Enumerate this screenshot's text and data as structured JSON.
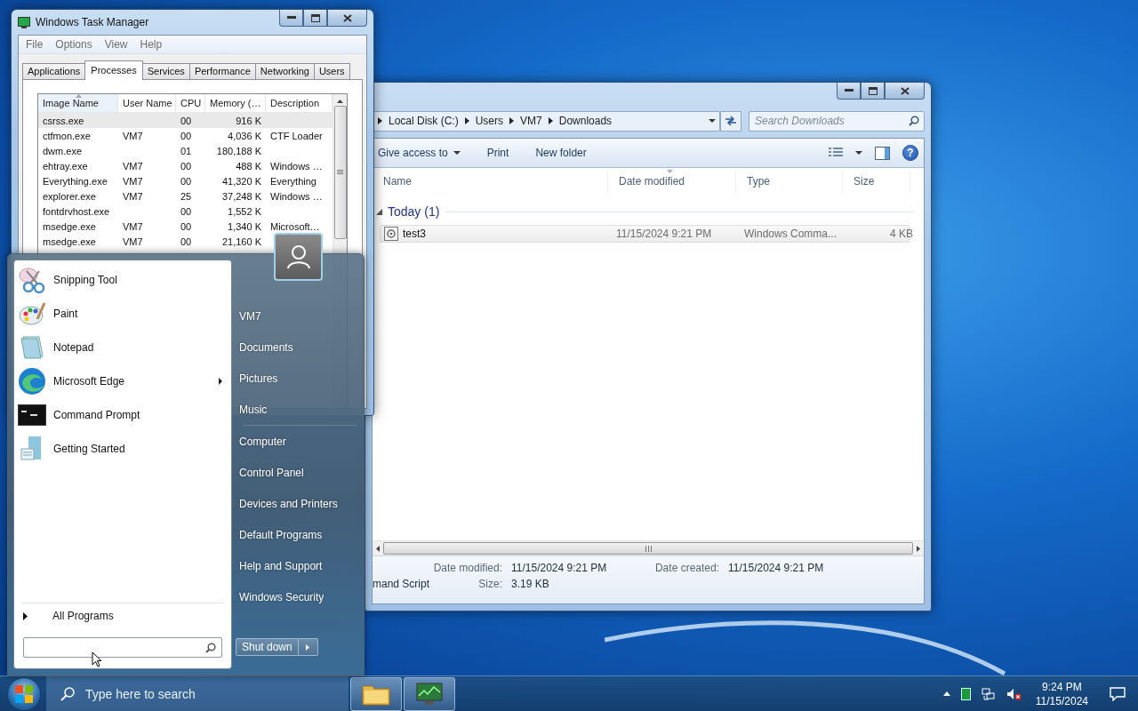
{
  "task_manager": {
    "title": "Windows Task Manager",
    "menu": [
      "File",
      "Options",
      "View",
      "Help"
    ],
    "tabs": [
      {
        "label": "Applications",
        "selected": false
      },
      {
        "label": "Processes",
        "selected": true
      },
      {
        "label": "Services",
        "selected": false
      },
      {
        "label": "Performance",
        "selected": false
      },
      {
        "label": "Networking",
        "selected": false
      },
      {
        "label": "Users",
        "selected": false
      }
    ],
    "columns": [
      "Image Name",
      "User Name",
      "CPU",
      "Memory (…",
      "Description"
    ],
    "rows": [
      {
        "name": "csrss.exe",
        "cpu": "00",
        "memory": "916 K",
        "selected": true
      },
      {
        "name": "ctfmon.exe",
        "user": "VM7",
        "cpu": "00",
        "memory": "4,036 K",
        "description": "CTF Loader",
        "selected": false
      },
      {
        "name": "dwm.exe",
        "cpu": "01",
        "memory": "180,188 K",
        "selected": false
      },
      {
        "name": "ehtray.exe",
        "user": "VM7",
        "cpu": "00",
        "memory": "488 K",
        "description": "Windows …",
        "selected": false
      },
      {
        "name": "Everything.exe",
        "user": "VM7",
        "cpu": "00",
        "memory": "41,320 K",
        "description": "Everything",
        "selected": false
      },
      {
        "name": "explorer.exe",
        "user": "VM7",
        "cpu": "25",
        "memory": "37,248 K",
        "description": "Windows …",
        "selected": false
      },
      {
        "name": "fontdrvhost.exe",
        "cpu": "00",
        "memory": "1,552 K",
        "selected": false
      },
      {
        "name": "msedge.exe",
        "user": "VM7",
        "cpu": "00",
        "memory": "1,340 K",
        "description": "Microsoft…",
        "selected": false
      },
      {
        "name": "msedge.exe",
        "user": "VM7",
        "cpu": "00",
        "memory": "21,160 K",
        "selected": false
      }
    ]
  },
  "explorer": {
    "breadcrumb": [
      "Local Disk (C:)",
      "Users",
      "VM7",
      "Downloads"
    ],
    "search": {
      "placeholder": "Search Downloads"
    },
    "toolbar": [
      {
        "label": "Give access to",
        "dropdown": true
      },
      {
        "label": "Print",
        "dropdown": false
      },
      {
        "label": "New folder",
        "dropdown": false
      }
    ],
    "help": "?",
    "columns": [
      "Name",
      "Date modified",
      "Type",
      "Size"
    ],
    "group": "Today (1)",
    "files": [
      {
        "name": "test3",
        "date": "11/15/2024 9:21 PM",
        "type": "Windows Comma...",
        "size": "4 KB",
        "selected": true
      }
    ],
    "details": {
      "fragment": "mand Script",
      "fields": [
        {
          "label": "Date modified:",
          "value": "11/15/2024 9:21 PM"
        },
        {
          "label": "Date created:",
          "value": "11/15/2024 9:21 PM"
        },
        {
          "label": "Size:",
          "value": "3.19 KB"
        }
      ]
    }
  },
  "start_menu": {
    "programs": [
      {
        "name": "Snipping Tool",
        "submenu": false
      },
      {
        "name": "Paint",
        "submenu": false
      },
      {
        "name": "Notepad",
        "submenu": false
      },
      {
        "name": "Microsoft Edge",
        "submenu": true
      },
      {
        "name": "Command Prompt",
        "submenu": false
      },
      {
        "name": "Getting Started",
        "submenu": false
      }
    ],
    "all_programs": "All Programs",
    "place_groups": [
      {
        "items": [
          "VM7",
          "Documents",
          "Pictures",
          "Music"
        ]
      },
      {
        "items": [
          "Computer",
          "Control Panel",
          "Devices and Printers",
          "Default Programs",
          "Help and Support",
          "Windows Security"
        ]
      }
    ],
    "shutdown": "Shut down"
  },
  "taskbar": {
    "search": {
      "placeholder": "Type here to search"
    },
    "time": "9:24 PM",
    "date": "11/15/2024"
  }
}
